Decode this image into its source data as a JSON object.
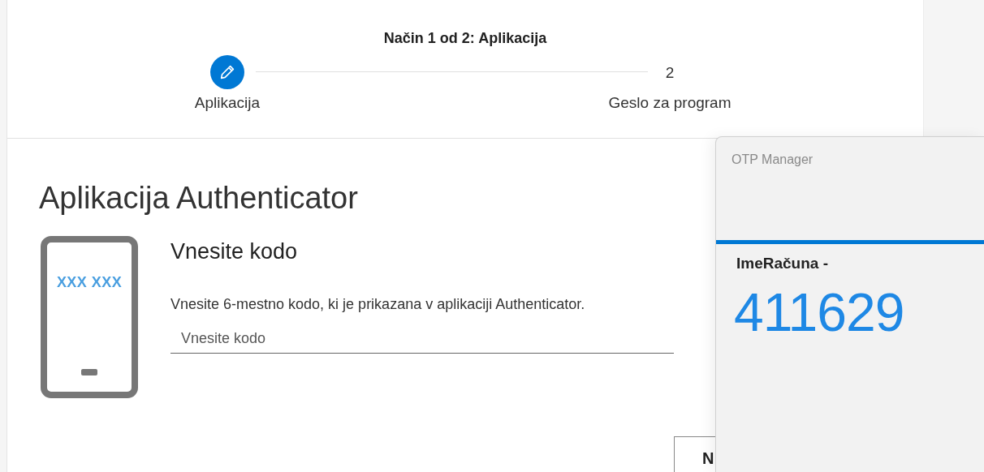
{
  "wizard": {
    "title": "Način 1 od 2: Aplikacija",
    "steps": [
      {
        "label": "Aplikacija",
        "selected": true
      },
      {
        "number": "2",
        "label": "Geslo za program",
        "selected": false
      }
    ]
  },
  "section": {
    "heading": "Aplikacija Authenticator",
    "phone_code": "XXX XXX",
    "title": "Vnesite kodo",
    "description": "Vnesite 6-mestno kodo, ki je prikazana v aplikaciji Authenticator.",
    "input": {
      "placeholder": "Vnesite kodo"
    },
    "button": "N"
  },
  "otp_window": {
    "title": "OTP Manager",
    "account": "ImeRačuna -",
    "code": "411629"
  }
}
